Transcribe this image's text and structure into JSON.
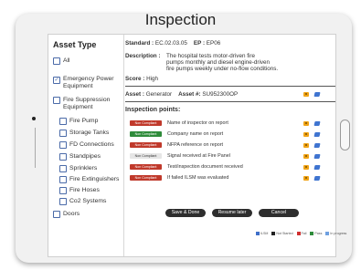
{
  "header": {
    "title": "Inspection"
  },
  "sidebar": {
    "heading": "Asset Type",
    "groups": [
      {
        "label": "All",
        "checked": false
      },
      {
        "label": "Emergency Power Equipment",
        "checked": true
      },
      {
        "label": "Fire Suppression Equipment",
        "checked": false
      },
      {
        "label": "Fire Pump",
        "checked": false
      },
      {
        "label": "Storage Tanks",
        "checked": false
      },
      {
        "label": "FD Connections",
        "checked": false
      },
      {
        "label": "Standpipes",
        "checked": false
      },
      {
        "label": "Sprinklers",
        "checked": false
      },
      {
        "label": "Fire Extinguishers",
        "checked": false
      },
      {
        "label": "Fire Hoses",
        "checked": false
      },
      {
        "label": "Co2 Systems",
        "checked": false
      },
      {
        "label": "Doors",
        "checked": false
      }
    ]
  },
  "standard": {
    "standard_label": "Standard :",
    "standard_value": "EC.02.03.05",
    "ep_label": "EP :",
    "ep_value": "EP06",
    "description_label": "Description :",
    "description_line1": "The hospital tests motor-driven fire",
    "description_line2": "pumps monthly and diesel engine-driven",
    "description_line3": "fire pumps weekly under no-flow conditions.",
    "score_label": "Score :",
    "score_value": "High"
  },
  "asset": {
    "asset_label": "Asset :",
    "asset_value": "Generator",
    "asset_no_label": "Asset #:",
    "asset_no_value": "SU952300OP"
  },
  "inspection": {
    "heading": "Inspection points:",
    "points": [
      {
        "status": "Non Compliant",
        "color": "#c0392b",
        "text": "Name of inspector on report"
      },
      {
        "status": "Non Compliant",
        "color": "#2e8b3a",
        "text": "Company name on report"
      },
      {
        "status": "Non Compliant",
        "color": "#c0392b",
        "text": "NFPA reference on report"
      },
      {
        "status": "Non Compliant",
        "color": "#e6e6e6",
        "text": "Signal received at Fire Panel"
      },
      {
        "status": "Non Compliant",
        "color": "#c0392b",
        "text": "Test/inspection document received"
      },
      {
        "status": "Non Compliant",
        "color": "#c0392b",
        "text": "If failed ILSM was evaluated"
      }
    ]
  },
  "actions": {
    "save_done": "Save & Done",
    "resume_later": "Resume later",
    "cancel": "Cancel"
  },
  "legend": [
    {
      "label": "ILSM",
      "color": "#3f6fc9"
    },
    {
      "label": "Not Started",
      "color": "#222222"
    },
    {
      "label": "Fail",
      "color": "#d03030"
    },
    {
      "label": "Pass",
      "color": "#2e8b3a"
    },
    {
      "label": "In progress",
      "color": "#6fa0e0"
    }
  ]
}
